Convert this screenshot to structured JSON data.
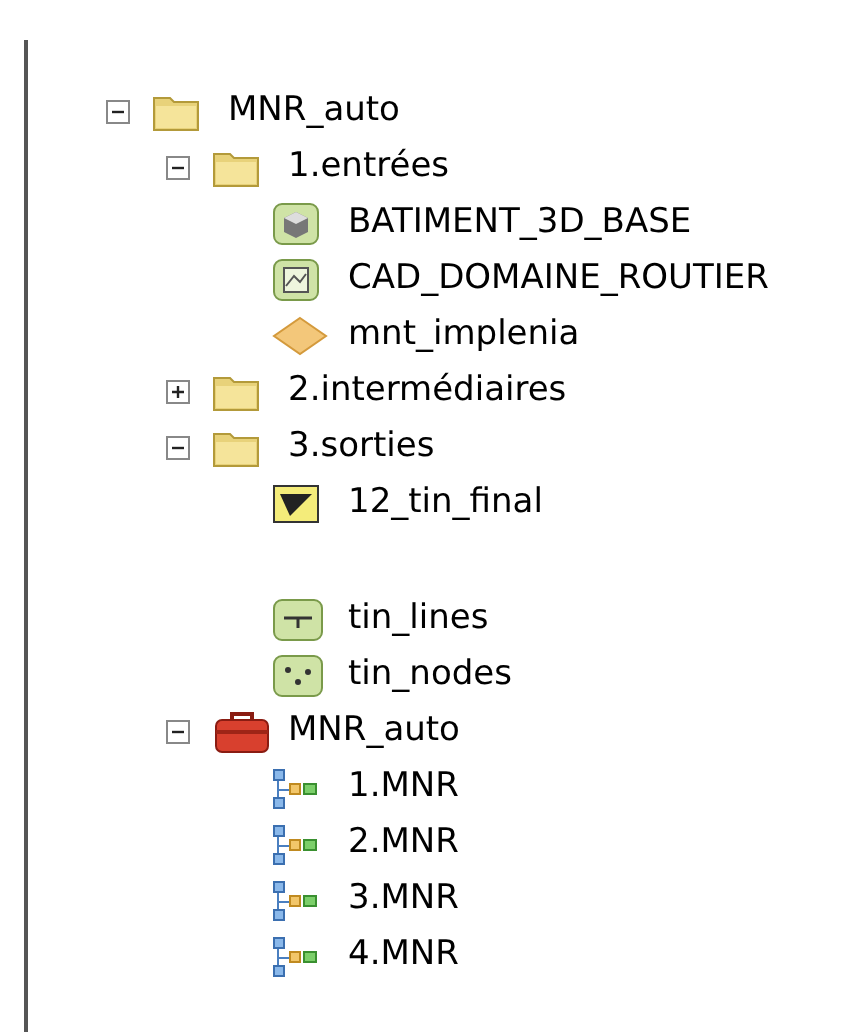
{
  "tree": [
    {
      "name": "MNR_auto",
      "kind": "folder",
      "expanded": true,
      "children": [
        {
          "name": "1.entrées",
          "kind": "folder",
          "expanded": true,
          "children": [
            {
              "name": "BATIMENT_3D_BASE",
              "kind": "multipatch"
            },
            {
              "name": "CAD_DOMAINE_ROUTIER",
              "kind": "cad"
            },
            {
              "name": "mnt_implenia",
              "kind": "raster"
            }
          ]
        },
        {
          "name": "2.intermédiaires",
          "kind": "folder",
          "expanded": false
        },
        {
          "name": "3.sorties",
          "kind": "folder",
          "expanded": true,
          "children": [
            {
              "name": "12_tin_final",
              "kind": "tin"
            },
            {
              "name": "tin_lines",
              "kind": "line"
            },
            {
              "name": "tin_nodes",
              "kind": "point"
            }
          ]
        },
        {
          "name": "MNR_auto",
          "kind": "toolbox",
          "expanded": true,
          "children": [
            {
              "name": "1.MNR",
              "kind": "model"
            },
            {
              "name": "2.MNR",
              "kind": "model"
            },
            {
              "name": "3.MNR",
              "kind": "model"
            },
            {
              "name": "4.MNR",
              "kind": "model"
            }
          ]
        }
      ]
    }
  ]
}
